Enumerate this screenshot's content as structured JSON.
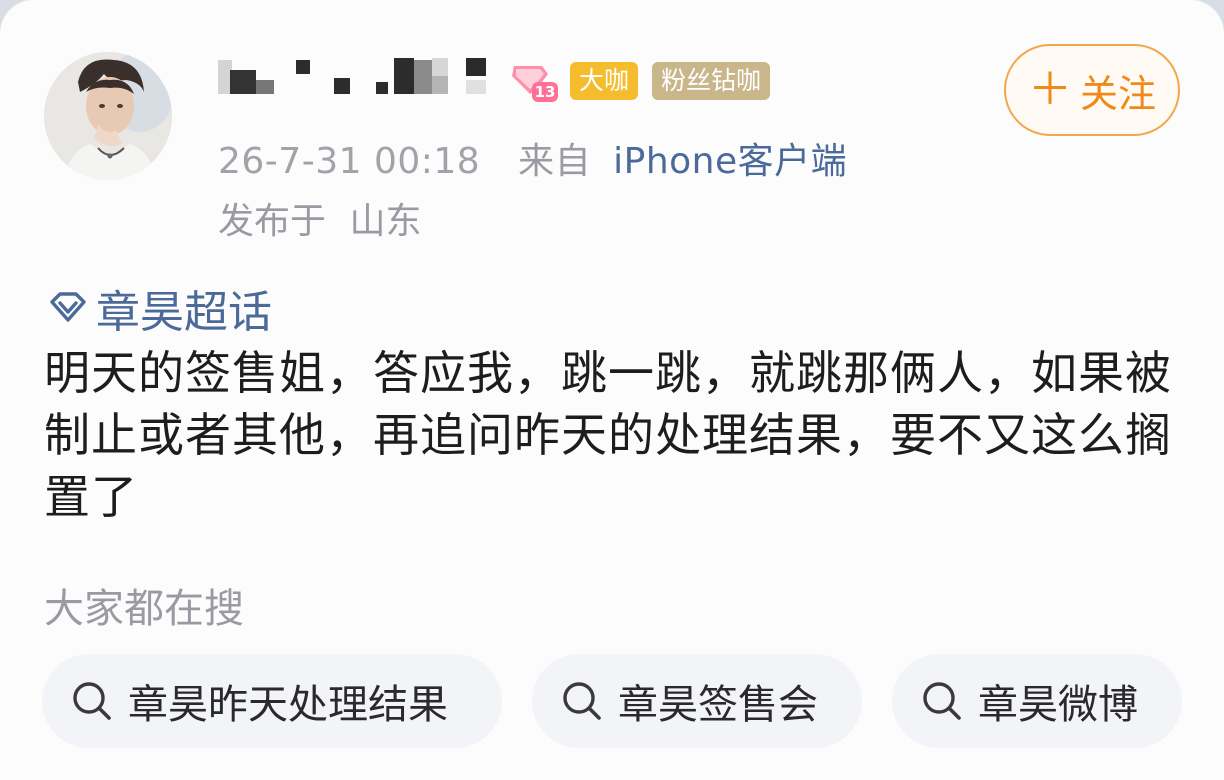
{
  "post": {
    "badges": {
      "daka": "大咖",
      "fans": "粉丝钻咖"
    },
    "time": "26-7-31 00:18",
    "from_prefix": "来自",
    "device": "iPhone客户端",
    "location_prefix": "发布于",
    "location": "山东",
    "follow_label": "关注",
    "topic": "章昊超话",
    "content": "明天的签售姐，答应我，跳一跳，就跳那俩人，如果被制止或者其他，再追问昨天的处理结果，要不又这么搁置了"
  },
  "search": {
    "label": "大家都在搜",
    "chips": [
      "章昊昨天处理结果",
      "章昊签售会",
      "章昊微博"
    ]
  },
  "colors": {
    "link": "#4b6a9a",
    "follow": "#ef8a1a",
    "badge_daka": "#f5bd2e",
    "badge_fans": "#c9b68a"
  },
  "icons": {
    "follow": "plus-icon",
    "topic": "super-topic-diamond-icon",
    "search": "search-icon",
    "vip": "vip-level-icon"
  }
}
